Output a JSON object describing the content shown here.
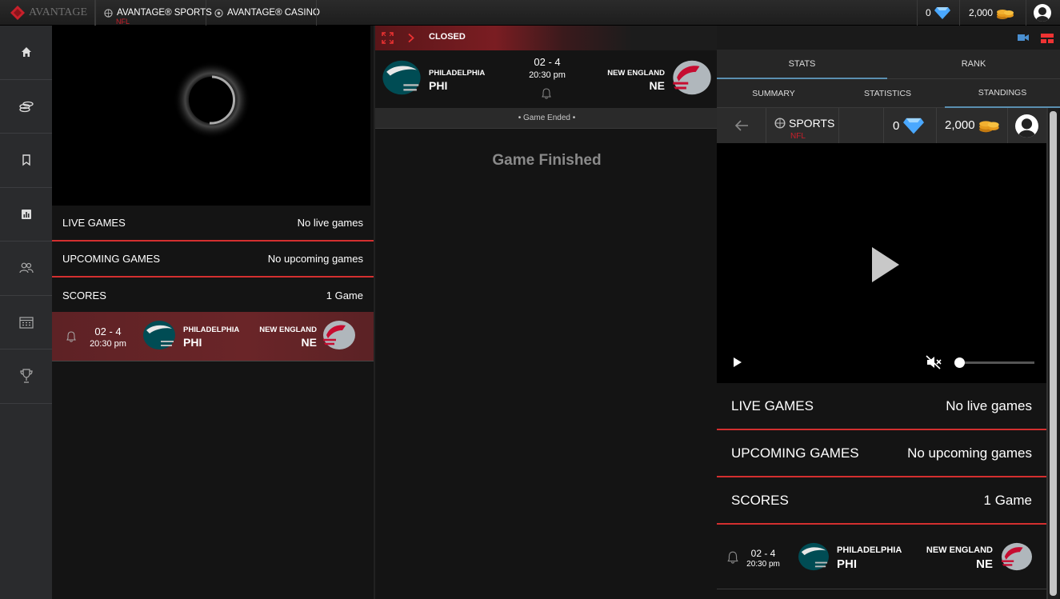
{
  "topbar": {
    "logo_text": "AVANTAGE",
    "tabs": [
      {
        "label": "AVANTAGE® SPORTS",
        "sub": "NFL"
      },
      {
        "label": "AVANTAGE® CASINO"
      }
    ],
    "diamonds": "0",
    "coins": "2,000"
  },
  "left_list": {
    "live_label": "LIVE GAMES",
    "live_value": "No live games",
    "upcoming_label": "UPCOMING GAMES",
    "upcoming_value": "No upcoming games",
    "scores_label": "SCORES",
    "scores_value": "1 Game"
  },
  "game": {
    "score": "02 - 4",
    "time": "20:30 pm",
    "home_name": "PHILADELPHIA",
    "home_abbr": "PHI",
    "away_name": "NEW ENGLAND",
    "away_abbr": "NE"
  },
  "center": {
    "status": "CLOSED",
    "ended_label": "• Game Ended •",
    "finished_label": "Game Finished"
  },
  "right": {
    "tabs": [
      "STATS",
      "RANK"
    ],
    "subtabs": [
      "SUMMARY",
      "STATISTICS",
      "STANDINGS"
    ],
    "embed": {
      "sports_label": "SPORTS",
      "sports_sub": "NFL",
      "diamonds": "0",
      "coins": "2,000"
    }
  },
  "colors": {
    "accent": "#d32f2f",
    "bg": "#141414",
    "sidebar": "#2a2b2d"
  }
}
